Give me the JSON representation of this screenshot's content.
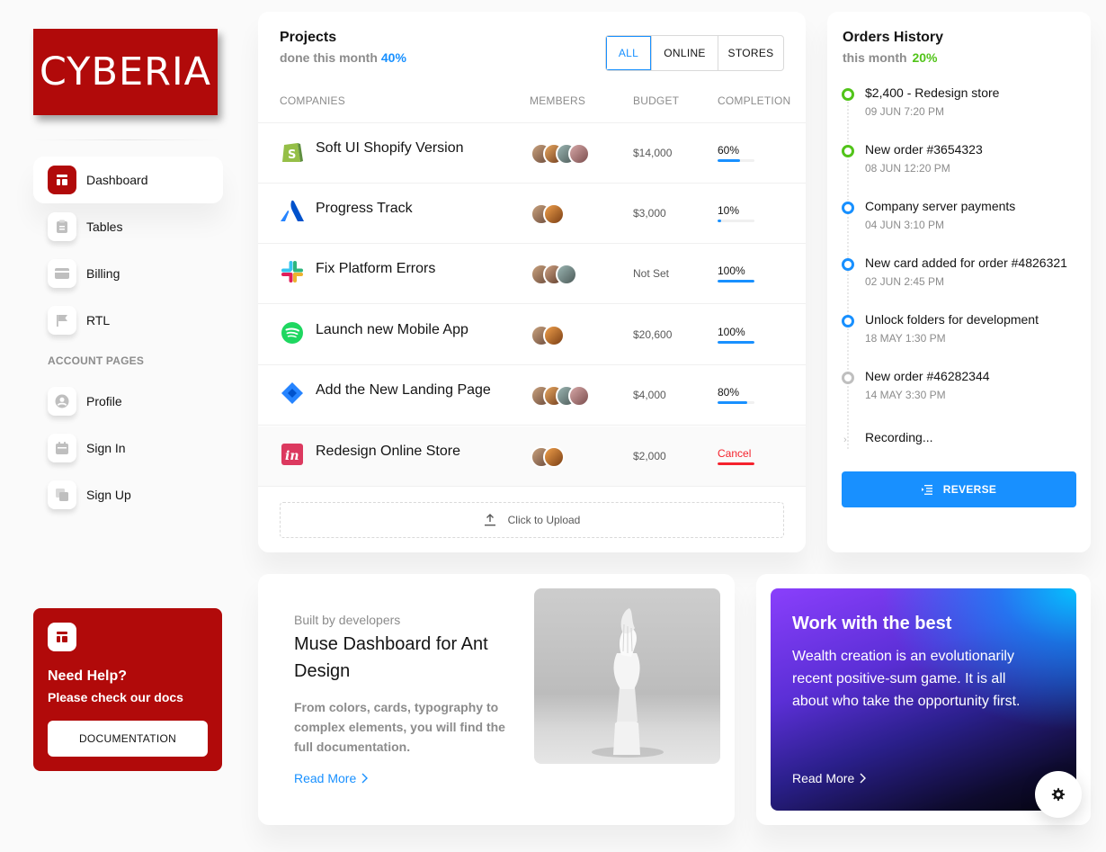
{
  "brand": {
    "logo_text": "CYBERIA",
    "color": "#b10a0a"
  },
  "sidebar": {
    "items": [
      {
        "label": "Dashboard",
        "icon": "dashboard-icon",
        "active": true
      },
      {
        "label": "Tables",
        "icon": "tables-icon"
      },
      {
        "label": "Billing",
        "icon": "billing-icon"
      },
      {
        "label": "RTL",
        "icon": "flag-icon"
      }
    ],
    "section_label": "ACCOUNT PAGES",
    "account_items": [
      {
        "label": "Profile",
        "icon": "profile-icon"
      },
      {
        "label": "Sign In",
        "icon": "signin-icon"
      },
      {
        "label": "Sign Up",
        "icon": "signup-icon"
      }
    ]
  },
  "help": {
    "title": "Need Help?",
    "subtitle": "Please check our docs",
    "button": "DOCUMENTATION"
  },
  "projects": {
    "title": "Projects",
    "subtitle": "done this month",
    "percent": "40%",
    "filters": [
      "ALL",
      "ONLINE",
      "STORES"
    ],
    "active_filter": "ALL",
    "columns": [
      "COMPANIES",
      "MEMBERS",
      "BUDGET",
      "COMPLETION"
    ],
    "rows": [
      {
        "name": "Soft UI Shopify Version",
        "logo": "shopify-icon",
        "members": 4,
        "budget": "$14,000",
        "completion": "60%",
        "progress": 0.6
      },
      {
        "name": "Progress Track",
        "logo": "atlassian-icon",
        "members": 2,
        "budget": "$3,000",
        "completion": "10%",
        "progress": 0.1
      },
      {
        "name": "Fix Platform Errors",
        "logo": "slack-icon",
        "members": 3,
        "budget": "Not Set",
        "completion": "100%",
        "progress": 1.0
      },
      {
        "name": "Launch new Mobile App",
        "logo": "spotify-icon",
        "members": 2,
        "budget": "$20,600",
        "completion": "100%",
        "progress": 1.0
      },
      {
        "name": "Add the New Landing Page",
        "logo": "jira-icon",
        "members": 4,
        "budget": "$4,000",
        "completion": "80%",
        "progress": 0.8
      },
      {
        "name": "Redesign Online Store",
        "logo": "invision-icon",
        "members": 2,
        "budget": "$2,000",
        "completion": "Cancel",
        "progress": 1.0,
        "cancelled": true
      }
    ],
    "upload_label": "Click to Upload"
  },
  "orders": {
    "title": "Orders History",
    "subtitle": "this month",
    "percent": "20%",
    "items": [
      {
        "title": "$2,400 - Redesign store",
        "date": "09 JUN 7:20 PM",
        "status": "green"
      },
      {
        "title": "New order #3654323",
        "date": "08 JUN 12:20 PM",
        "status": "green"
      },
      {
        "title": "Company server payments",
        "date": "04 JUN 3:10 PM",
        "status": "blue"
      },
      {
        "title": "New card added for order #4826321",
        "date": "02 JUN 2:45 PM",
        "status": "blue"
      },
      {
        "title": "Unlock folders for development",
        "date": "18 MAY 1:30 PM",
        "status": "blue"
      },
      {
        "title": "New order #46282344",
        "date": "14 MAY 3:30 PM",
        "status": "gray"
      }
    ],
    "recording": "Recording...",
    "button": "REVERSE"
  },
  "muse": {
    "kicker": "Built by developers",
    "title": "Muse Dashboard for Ant Design",
    "description": "From colors, cards, typography to complex elements, you will find the full documentation.",
    "link": "Read More"
  },
  "work": {
    "title": "Work with the best",
    "description": "Wealth creation is an evolutionarily recent positive-sum game. It is all about who take the opportunity first.",
    "link": "Read More"
  },
  "colors": {
    "primary": "#1890ff",
    "success": "#52c41a",
    "danger": "#f5222d",
    "muted": "#8c8c8c"
  }
}
